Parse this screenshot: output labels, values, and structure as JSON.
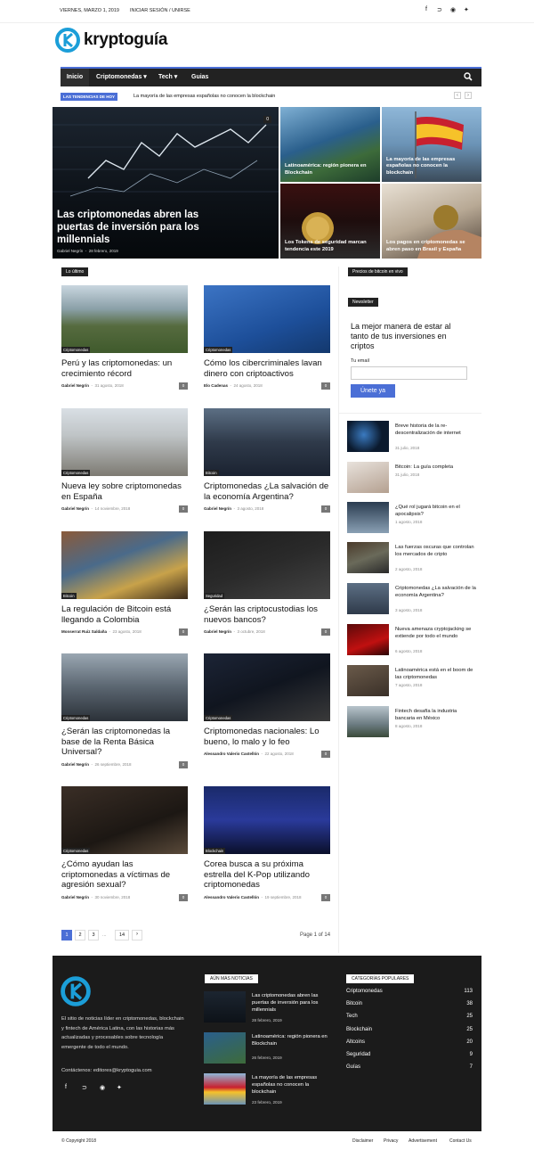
{
  "topbar": {
    "date": "VIERNES, MARZO 1, 2019",
    "login": "INICIAR SESIÓN / UNIRSE",
    "social": [
      "facebook-icon",
      "rss-icon",
      "telegram-icon",
      "twitter-icon"
    ]
  },
  "logo": {
    "text": "kryptoguía",
    "accent": "#1b9ed8"
  },
  "nav": {
    "items": [
      "Inicio",
      "Criptomonedas",
      "Tech",
      "Guias"
    ],
    "active": "Inicio"
  },
  "trending": {
    "label": "LAS TENDENCIAS DE HOY",
    "headline": "La mayoría de las empresas españolas no conocen la blockchain"
  },
  "hero": {
    "main": {
      "title": "Las criptomonedas abren las puertas de inversión para los millennials",
      "author": "Gabriel Negrín",
      "date": "28 febrero, 2019",
      "comments": "0"
    },
    "tiles": [
      {
        "title": "Latinoamérica: región pionera en Blockchain"
      },
      {
        "title": "La mayoría de las empresas españolas no conocen la blockchain"
      },
      {
        "title": "Los Tokens de seguridad marcan tendencia este 2019"
      },
      {
        "title": "Los pagos en criptomonedas se abren paso en Brasil y España"
      }
    ]
  },
  "latest": {
    "heading": "Lo último",
    "cards": [
      {
        "cat": "Criptomonedas",
        "title": "Perú y las criptomonedas: un crecimiento récord",
        "author": "Gabriel Negrín",
        "date": "31 agosto, 2018",
        "comments": "0"
      },
      {
        "cat": "Criptomonedas",
        "title": "Cómo los cibercriminales lavan dinero con criptoactivos",
        "author": "Elo Cadenas",
        "date": "24 agosto, 2018",
        "comments": "0"
      },
      {
        "cat": "Criptomonedas",
        "title": "Nueva ley sobre criptomonedas en España",
        "author": "Gabriel Negrín",
        "date": "14 noviembre, 2018",
        "comments": "0"
      },
      {
        "cat": "Bitcoin",
        "title": "Criptomonedas ¿La salvación de la economía Argentina?",
        "author": "Gabriel Negrín",
        "date": "3 agosto, 2018",
        "comments": "0"
      },
      {
        "cat": "Bitcoin",
        "title": "La regulación de Bitcoin está llegando a Colombia",
        "author": "Monserrat Ruiz Saldaña",
        "date": "23 agosto, 2018",
        "comments": "0"
      },
      {
        "cat": "Seguridad",
        "title": "¿Serán las criptocustodias los nuevos bancos?",
        "author": "Gabriel Negrín",
        "date": "3 octubre, 2018",
        "comments": "0"
      },
      {
        "cat": "Criptomonedas",
        "title": "¿Serán las criptomonedas la base de la Renta Básica Universal?",
        "author": "Gabriel Negrín",
        "date": "26 septiembre, 2018",
        "comments": "0"
      },
      {
        "cat": "Criptomonedas",
        "title": "Criptomonedas nacionales: Lo bueno, lo malo y lo feo",
        "author": "Alessandro Valerio Castellón",
        "date": "22 agosto, 2018",
        "comments": "0"
      },
      {
        "cat": "Criptomonedas",
        "title": "¿Cómo ayudan las criptomonedas a víctimas de agresión sexual?",
        "author": "Gabriel Negrín",
        "date": "30 noviembre, 2018",
        "comments": "0"
      },
      {
        "cat": "Blockchain",
        "title": "Corea busca a su próxima estrella del K-Pop utilizando criptomonedas",
        "author": "Alessandro Valerio Castellón",
        "date": "19 septiembre, 2018",
        "comments": "0"
      }
    ]
  },
  "pagination": {
    "pages": [
      "1",
      "2",
      "3",
      "...",
      "14"
    ],
    "next": "›",
    "status": "Page 1 of 14"
  },
  "sidebar": {
    "prices_heading": "Precios de bitcoin en vivo",
    "newsletter": {
      "heading": "Newsletter",
      "title": "La mejor manera de estar al tanto de tus inversiones en criptos",
      "label": "Tu email",
      "button": "Únete ya"
    },
    "items": [
      {
        "title": "Breve historia de la re-descentralización de internet",
        "date": "31 julio, 2018"
      },
      {
        "title": "Bitcoin: La guía completa",
        "date": "31 julio, 2018"
      },
      {
        "title": "¿Qué rol jugará bitcoin en el apocalipsis?",
        "date": "1 agosto, 2018"
      },
      {
        "title": "Las fuerzas oscuras que controlan los mercados de cripto",
        "date": "2 agosto, 2018"
      },
      {
        "title": "Criptomonedas ¿La salvación de la economía Argentina?",
        "date": "3 agosto, 2018"
      },
      {
        "title": "Nueva amenaza cryptojacking se extiende por todo el mundo",
        "date": "6 agosto, 2018"
      },
      {
        "title": "Latinoamérica está en el boom de las criptomonedas",
        "date": "7 agosto, 2018"
      },
      {
        "title": "Fintech desafía la industria bancaria en México",
        "date": "8 agosto, 2018"
      }
    ]
  },
  "footer": {
    "about": "El sitio de noticias líder en criptomonedas, blockchain y fintech de América Latina, con las historias más actualizadas y procesables sobre tecnología emergente de todo el mundo.",
    "contact": "Contáctenos: editores@kryptoguia.com",
    "more_heading": "AÚN MÁS NOTICIAS",
    "more": [
      {
        "title": "Las criptomonedas abren las puertas de inversión para los millennials",
        "date": "28 febrero, 2019"
      },
      {
        "title": "Latinoamérica: región pionera en Blockchain",
        "date": "26 febrero, 2019"
      },
      {
        "title": "La mayoría de las empresas españolas no conocen la blockchain",
        "date": "23 febrero, 2019"
      }
    ],
    "cats_heading": "CATEGORÍAS POPULARES",
    "cats": [
      {
        "name": "Criptomonedas",
        "count": "113"
      },
      {
        "name": "Bitcoin",
        "count": "38"
      },
      {
        "name": "Tech",
        "count": "25"
      },
      {
        "name": "Blockchain",
        "count": "25"
      },
      {
        "name": "Altcoins",
        "count": "20"
      },
      {
        "name": "Seguridad",
        "count": "9"
      },
      {
        "name": "Guías",
        "count": "7"
      }
    ]
  },
  "bottombar": {
    "copyright": "© Copyright 2018",
    "links": [
      "Disclaimer",
      "Privacy",
      "Advertisement",
      "Contact Us"
    ]
  }
}
